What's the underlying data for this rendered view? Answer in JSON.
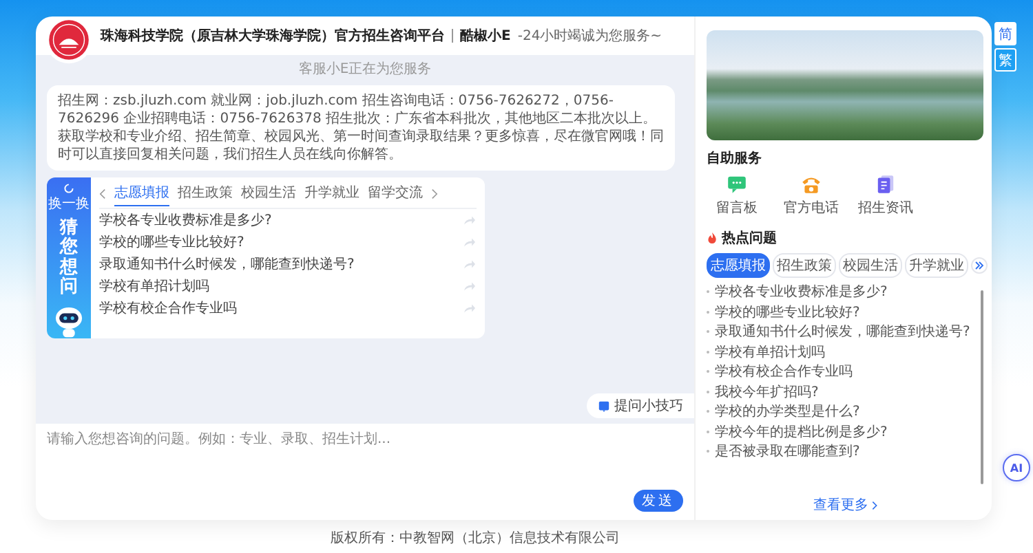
{
  "header": {
    "title": "珠海科技学院（原吉林大学珠海学院）官方招生咨询平台",
    "agent_name": "酷椒小E",
    "slogan": "-24小时竭诚为您服务~"
  },
  "chat": {
    "status": "客服小E正在为您服务",
    "welcome": "招生网：zsb.jluzh.com 就业网：job.jluzh.com 招生咨询电话：0756-7626272，0756-7626296 企业招聘电话：0756-7626378 招生批次：广东省本科批次，其他地区二本批次以上。获取学校和专业介绍、招生简章、校园风光、第一时间查询录取结果？更多惊喜，尽在微官网哦！同时可以直接回复相关问题，我们招生人员在线向你解答。",
    "card": {
      "refresh": "换一换",
      "side_title": "猜您想问",
      "tabs": [
        {
          "label": "志愿填报",
          "selected": true
        },
        {
          "label": "招生政策",
          "selected": false
        },
        {
          "label": "校园生活",
          "selected": false
        },
        {
          "label": "升学就业",
          "selected": false
        },
        {
          "label": "留学交流",
          "selected": false
        }
      ],
      "questions": [
        "学校各专业收费标准是多少?",
        "学校的哪些专业比较好?",
        "录取通知书什么时候发，哪能查到快递号?",
        "学校有单招计划吗",
        "学校有校企合作专业吗"
      ]
    },
    "tips_button": "提问小技巧"
  },
  "input": {
    "placeholder": "请输入您想咨询的问题。例如：专业、录取、招生计划...",
    "send_button": "发送"
  },
  "right": {
    "self_service": {
      "title": "自助服务",
      "items": [
        {
          "label": "留言板",
          "kind": "message"
        },
        {
          "label": "官方电话",
          "kind": "phone"
        },
        {
          "label": "招生资讯",
          "kind": "news"
        }
      ]
    },
    "hot": {
      "title": "热点问题",
      "tabs": [
        {
          "label": "志愿填报",
          "selected": true
        },
        {
          "label": "招生政策",
          "selected": false
        },
        {
          "label": "校园生活",
          "selected": false
        },
        {
          "label": "升学就业",
          "selected": false
        }
      ],
      "questions": [
        "学校各专业收费标准是多少?",
        "学校的哪些专业比较好?",
        "录取通知书什么时候发，哪能查到快递号?",
        "学校有单招计划吗",
        "学校有校企合作专业吗",
        "我校今年扩招吗?",
        "学校的办学类型是什么?",
        "学校今年的提档比例是多少?",
        "是否被录取在哪能查到?"
      ],
      "more": "查看更多"
    }
  },
  "footer": "版权所有：中教智网（北京）信息技术有限公司",
  "lang_toggle": [
    {
      "label": "简",
      "selected": true
    },
    {
      "label": "繁",
      "selected": false
    }
  ],
  "ai_button": "AI"
}
